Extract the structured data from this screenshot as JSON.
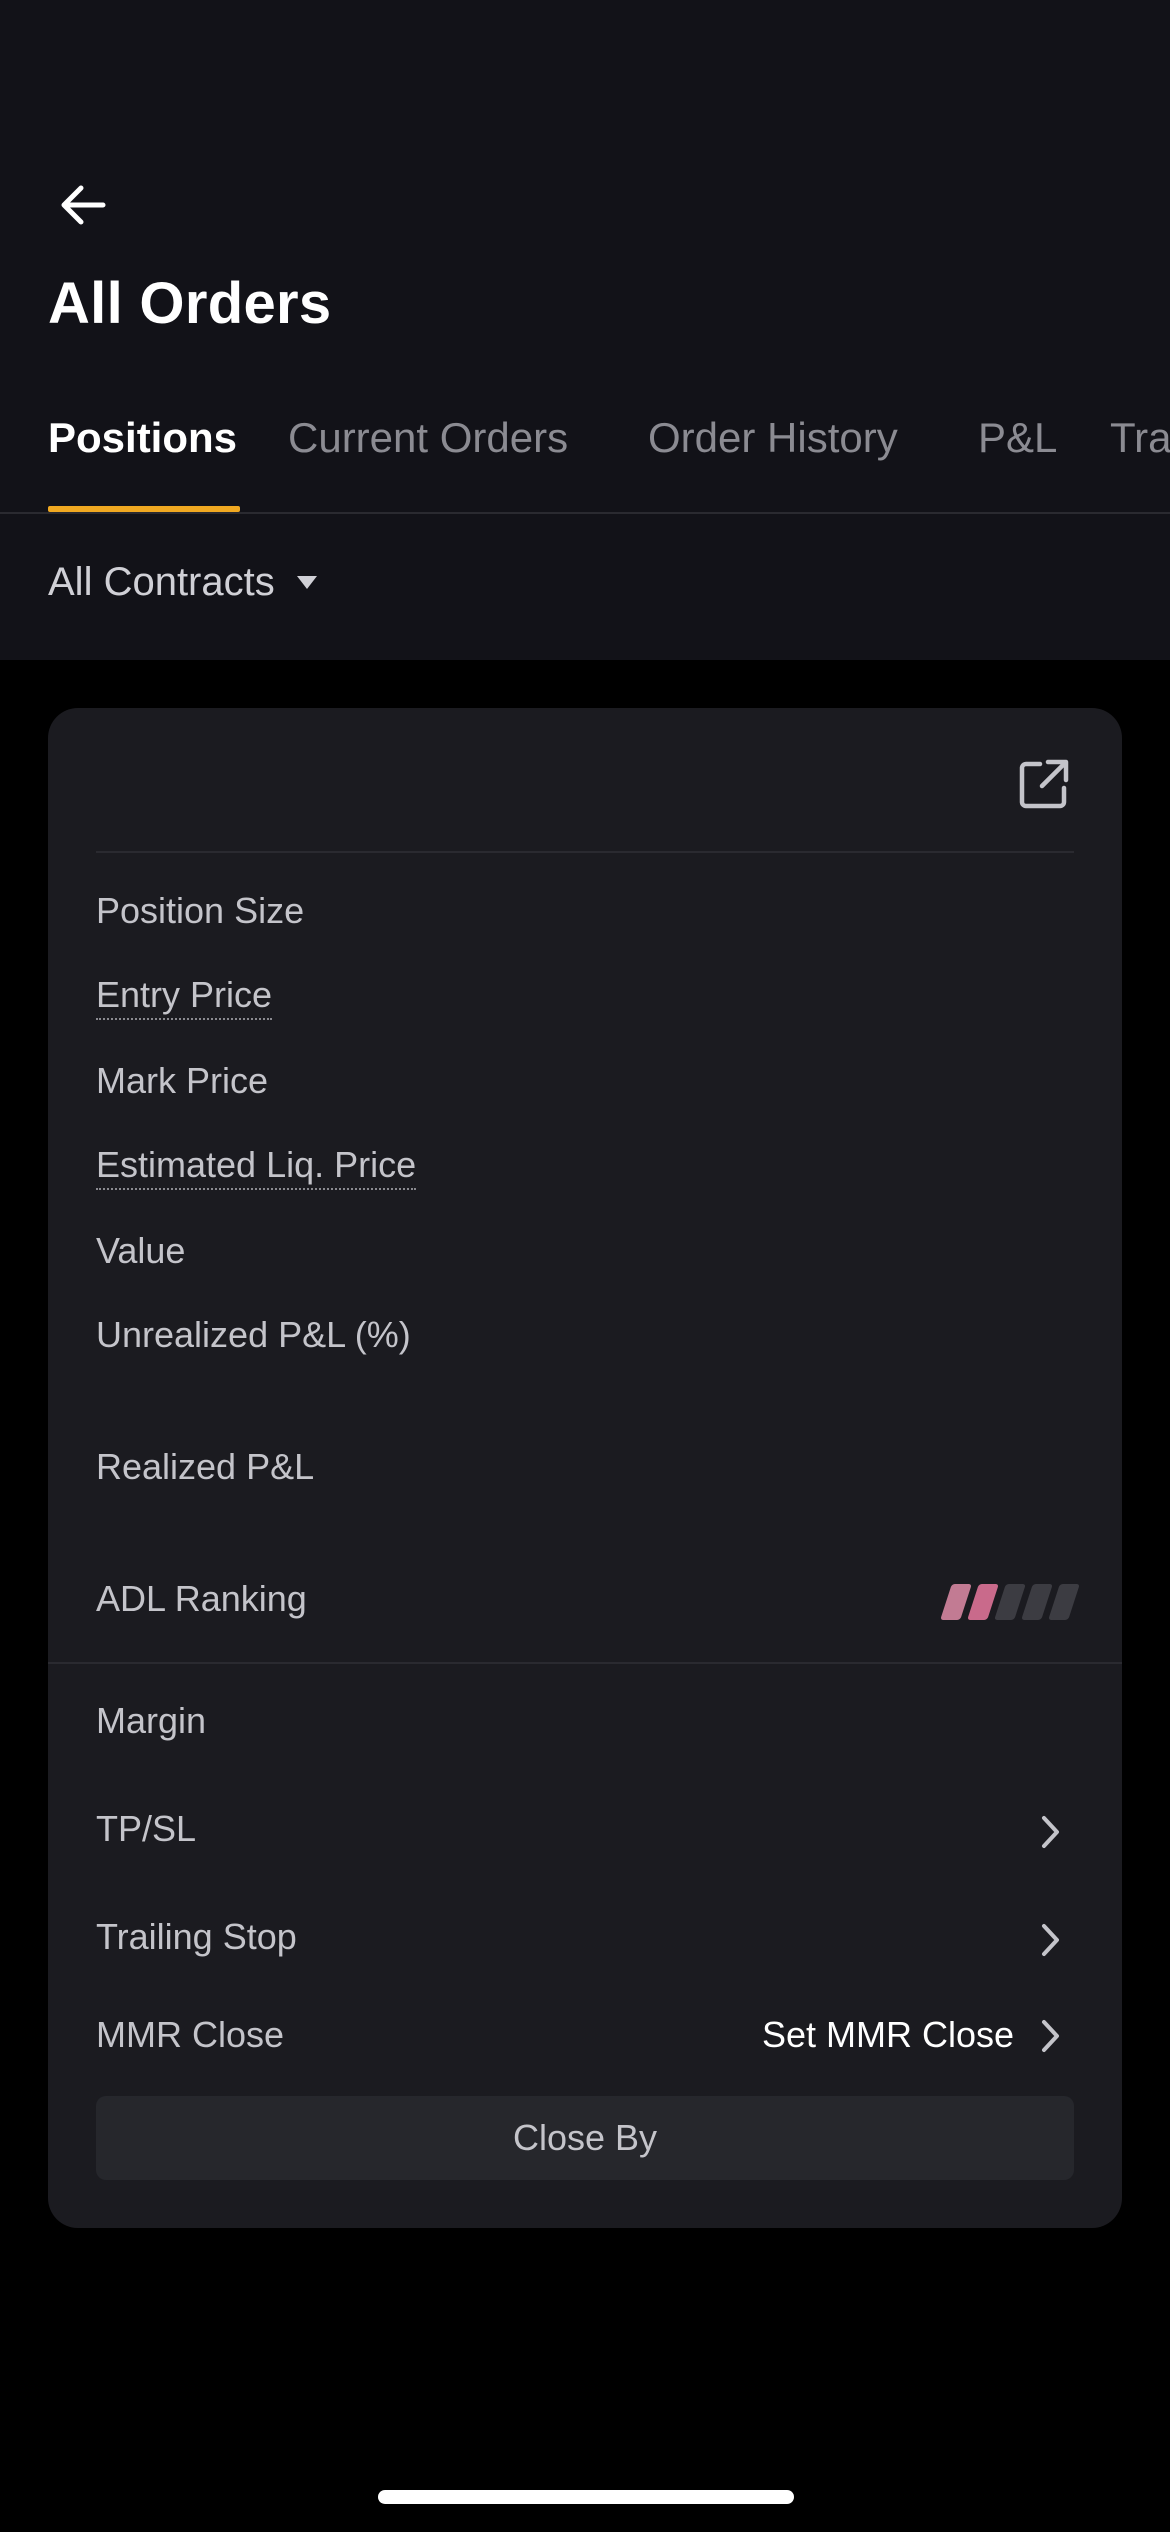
{
  "header": {
    "title": "All Orders",
    "back_icon": "arrow-left-icon"
  },
  "tabs": [
    {
      "label": "Positions",
      "active": true
    },
    {
      "label": "Current Orders",
      "active": false
    },
    {
      "label": "Order History",
      "active": false
    },
    {
      "label": "P&L",
      "active": false
    },
    {
      "label": "Trades",
      "active": false
    }
  ],
  "filter": {
    "label": "All Contracts",
    "icon": "caret-down-icon"
  },
  "position_card": {
    "share_icon": "external-link-icon",
    "fields": {
      "position_size": "Position Size",
      "entry_price": "Entry Price",
      "mark_price": "Mark Price",
      "estimated_liq_price": "Estimated Liq. Price",
      "value": "Value",
      "unrealized_pnl": "Unrealized P&L (%)",
      "realized_pnl": "Realized P&L",
      "adl_ranking": "ADL Ranking"
    },
    "adl_level": 2,
    "adl_max": 5,
    "margin": "Margin",
    "tp_sl": "TP/SL",
    "trailing_stop": "Trailing Stop",
    "mmr_close": "MMR Close",
    "mmr_close_action": "Set MMR Close",
    "close_by": "Close By"
  },
  "colors": {
    "accent": "#f0a821",
    "header_bg": "#121218",
    "card_bg": "#1b1b20",
    "adl_active": "#c96a8b"
  }
}
